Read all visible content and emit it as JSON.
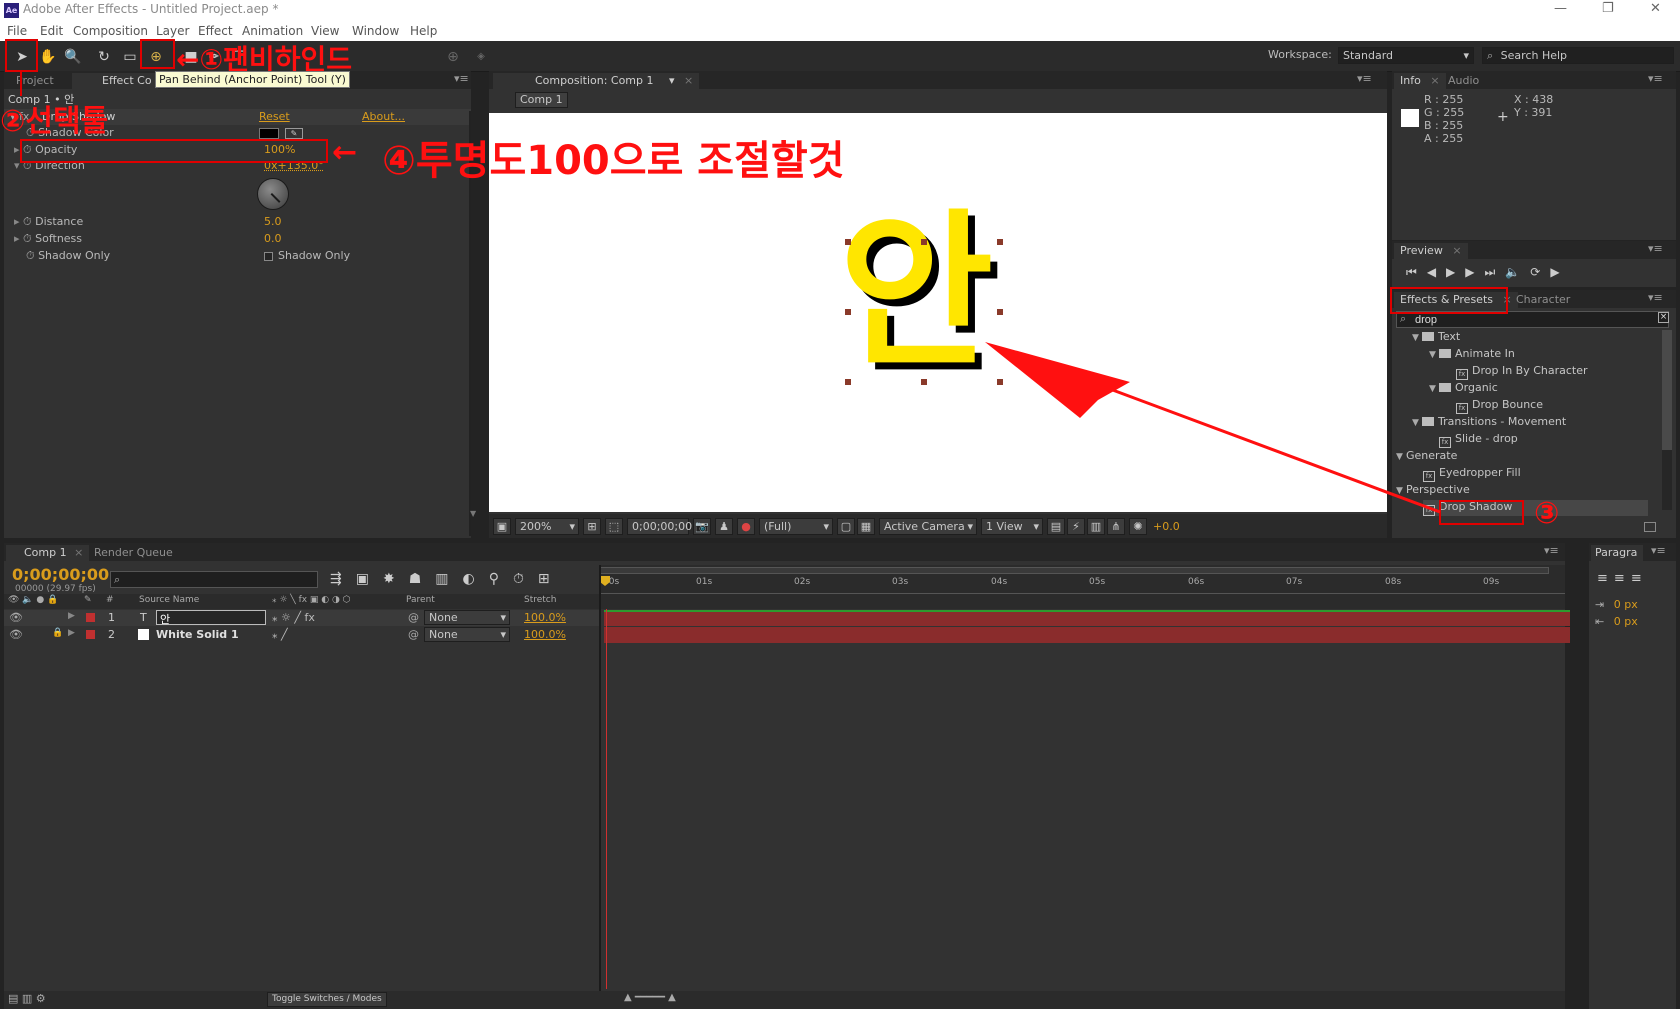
{
  "app": {
    "icon_text": "Ae",
    "title": "Adobe After Effects - Untitled Project.aep *"
  },
  "menu": [
    "File",
    "Edit",
    "Composition",
    "Layer",
    "Effect",
    "Animation",
    "View",
    "Window",
    "Help"
  ],
  "toolbar": {
    "tooltip": "Pan Behind (Anchor Point) Tool (Y)",
    "workspace_label": "Workspace:",
    "workspace_value": "Standard",
    "search_help": "Search Help"
  },
  "annotations": {
    "a1": "←①팬비하인드",
    "a2": "②선택툴",
    "a3": "③",
    "a4": "④투명도100으로 조절할것",
    "arrow_left": "←"
  },
  "project_panel": {
    "tab_project": "Project",
    "tab_effect": "Effect Co",
    "breadcrumb": "Comp 1 • 안",
    "effect_name": "Drop Shadow",
    "reset": "Reset",
    "about": "About...",
    "props": [
      {
        "name": "Shadow Color",
        "value": ""
      },
      {
        "name": "Opacity",
        "value": "100%"
      },
      {
        "name": "Direction",
        "value": "0x+135.0°"
      },
      {
        "name": "Distance",
        "value": "5.0"
      },
      {
        "name": "Softness",
        "value": "0.0"
      },
      {
        "name": "Shadow Only",
        "value": "Shadow Only"
      }
    ]
  },
  "composition": {
    "tab": "Composition: Comp 1",
    "subtab": "Comp 1",
    "glyph": "안",
    "footer": {
      "zoom": "200%",
      "timecode": "0;00;00;00",
      "resolution": "(Full)",
      "camera": "Active Camera",
      "view": "1 View",
      "exposure": "+0.0"
    }
  },
  "info": {
    "tab_info": "Info",
    "tab_audio": "Audio",
    "r": "R : 255",
    "g": "G : 255",
    "b": "B : 255",
    "a": "A : 255",
    "x": "X : 438",
    "y": "Y : 391"
  },
  "preview": {
    "tab": "Preview"
  },
  "effects_presets": {
    "tab": "Effects & Presets",
    "tab2": "Character",
    "search": "drop",
    "tree": [
      {
        "label": "Text",
        "kind": "folder",
        "indent": 1
      },
      {
        "label": "Animate In",
        "kind": "folder",
        "indent": 2
      },
      {
        "label": "Drop In By Character",
        "kind": "fx",
        "indent": 3
      },
      {
        "label": "Organic",
        "kind": "folder",
        "indent": 2
      },
      {
        "label": "Drop Bounce",
        "kind": "fx",
        "indent": 3
      },
      {
        "label": "Transitions - Movement",
        "kind": "folder",
        "indent": 1
      },
      {
        "label": "Slide - drop",
        "kind": "fx",
        "indent": 2
      },
      {
        "label": "Generate",
        "kind": "group",
        "indent": 0
      },
      {
        "label": "Eyedropper Fill",
        "kind": "fx",
        "indent": 1
      },
      {
        "label": "Perspective",
        "kind": "group",
        "indent": 0
      },
      {
        "label": "Drop Shadow",
        "kind": "fx",
        "indent": 1
      }
    ]
  },
  "timeline": {
    "tab": "Comp 1",
    "tab2": "Render Queue",
    "timecode": "0;00;00;00",
    "fps": "00000 (29.97 fps)",
    "col_num": "#",
    "col_source": "Source Name",
    "col_parent": "Parent",
    "col_stretch": "Stretch",
    "ruler": [
      "00s",
      "01s",
      "02s",
      "03s",
      "04s",
      "05s",
      "06s",
      "07s",
      "08s",
      "09s"
    ],
    "layers": [
      {
        "num": "1",
        "name": "안",
        "parent": "None",
        "stretch": "100.0%"
      },
      {
        "num": "2",
        "name": "White Solid 1",
        "parent": "None",
        "stretch": "100.0%"
      }
    ],
    "toggle": "Toggle Switches / Modes"
  },
  "paragraph": {
    "tab": "Paragra",
    "px1": "0 px",
    "px2": "0 px"
  },
  "colors": {
    "annotation_red": "#e00000",
    "text_yellow": "#ffe600",
    "value_orange": "#d99c1c",
    "layer_bar": "#8a2c2c"
  }
}
